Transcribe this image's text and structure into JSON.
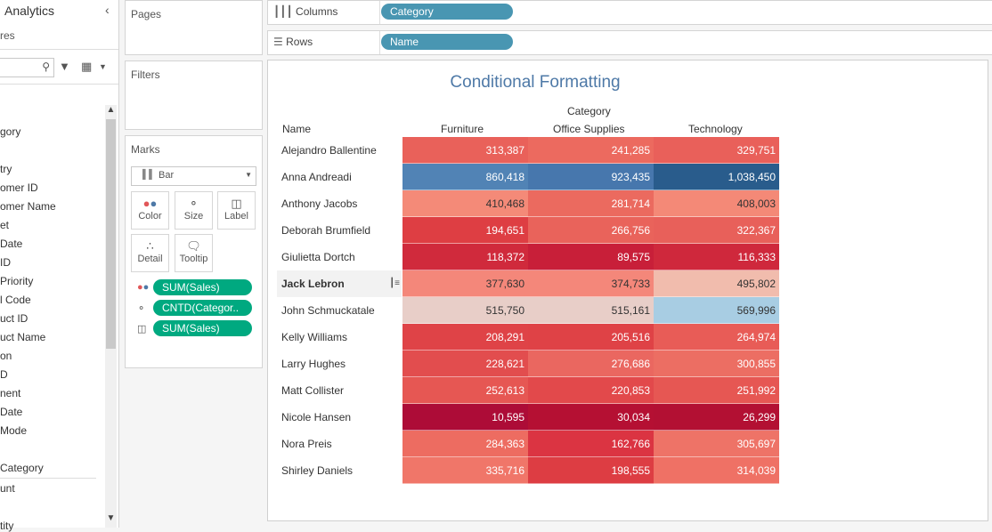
{
  "left_pane": {
    "tab_label": "Analytics",
    "measures_partial": "res",
    "fields": [
      "gory",
      "try",
      "omer ID",
      "omer Name",
      "et",
      "Date",
      "ID",
      "Priority",
      "l Code",
      "uct ID",
      "uct Name",
      "on",
      "D",
      "nent",
      "Date",
      "Mode"
    ],
    "measure_header": "Category",
    "measures": [
      "unt",
      "",
      "tity"
    ]
  },
  "shelves": {
    "pages_label": "Pages",
    "filters_label": "Filters",
    "columns_label": "Columns",
    "rows_label": "Rows",
    "columns_pill": "Category",
    "rows_pill": "Name"
  },
  "marks": {
    "title": "Marks",
    "type": "Bar",
    "buttons": [
      "Color",
      "Size",
      "Label",
      "Detail",
      "Tooltip"
    ],
    "pills": [
      "SUM(Sales)",
      "CNTD(Categor..",
      "SUM(Sales)"
    ]
  },
  "view": {
    "title": "Conditional Formatting",
    "column_group": "Category",
    "row_header": "Name",
    "columns": [
      "Furniture",
      "Office Supplies",
      "Technology"
    ],
    "rows": [
      {
        "name": "Alejandro Ballentine",
        "values": [
          "313,387",
          "241,285",
          "329,751"
        ],
        "colors": [
          "#e9615a",
          "#ec6a5f",
          "#e9605a"
        ]
      },
      {
        "name": "Anna Andreadi",
        "values": [
          "860,418",
          "923,435",
          "1,038,450"
        ],
        "colors": [
          "#5183b5",
          "#4777ad",
          "#295c8c"
        ]
      },
      {
        "name": "Anthony Jacobs",
        "values": [
          "410,468",
          "281,714",
          "408,003"
        ],
        "colors": [
          "#f48a78",
          "#eb6a5f",
          "#f48977"
        ]
      },
      {
        "name": "Deborah Brumfield",
        "values": [
          "194,651",
          "266,756",
          "322,367"
        ],
        "colors": [
          "#de3e43",
          "#e9635b",
          "#e8605a"
        ]
      },
      {
        "name": "Giulietta Dortch",
        "values": [
          "118,372",
          "89,575",
          "116,333"
        ],
        "colors": [
          "#d02a3c",
          "#c81f39",
          "#cf283c"
        ]
      },
      {
        "name": "Jack Lebron",
        "values": [
          "377,630",
          "374,733",
          "495,802"
        ],
        "colors": [
          "#f4877a",
          "#f4877a",
          "#f1bcad"
        ]
      },
      {
        "name": "John Schmuckatale",
        "values": [
          "515,750",
          "515,161",
          "569,996"
        ],
        "colors": [
          "#e8cec8",
          "#e8cec8",
          "#a8cde3"
        ]
      },
      {
        "name": "Kelly Williams",
        "values": [
          "208,291",
          "205,516",
          "264,974"
        ],
        "colors": [
          "#df4347",
          "#df4246",
          "#e85c57"
        ]
      },
      {
        "name": "Larry Hughes",
        "values": [
          "228,621",
          "276,686",
          "300,855"
        ],
        "colors": [
          "#e24d4e",
          "#ea6760",
          "#ec6e63"
        ]
      },
      {
        "name": "Matt Collister",
        "values": [
          "252,613",
          "220,853",
          "251,992"
        ],
        "colors": [
          "#e65753",
          "#e2494b",
          "#e65753"
        ]
      },
      {
        "name": "Nicole Hansen",
        "values": [
          "10,595",
          "30,034",
          "26,299"
        ],
        "colors": [
          "#ad0c37",
          "#b51033",
          "#b31033"
        ]
      },
      {
        "name": "Nora Preis",
        "values": [
          "284,363",
          "162,766",
          "305,697"
        ],
        "colors": [
          "#ed6c61",
          "#db3442",
          "#ee7367"
        ]
      },
      {
        "name": "Shirley Daniels",
        "values": [
          "335,716",
          "198,555",
          "314,039"
        ],
        "colors": [
          "#f07669",
          "#dd3d43",
          "#ef7165"
        ]
      }
    ],
    "selected_row": "Jack Lebron"
  }
}
